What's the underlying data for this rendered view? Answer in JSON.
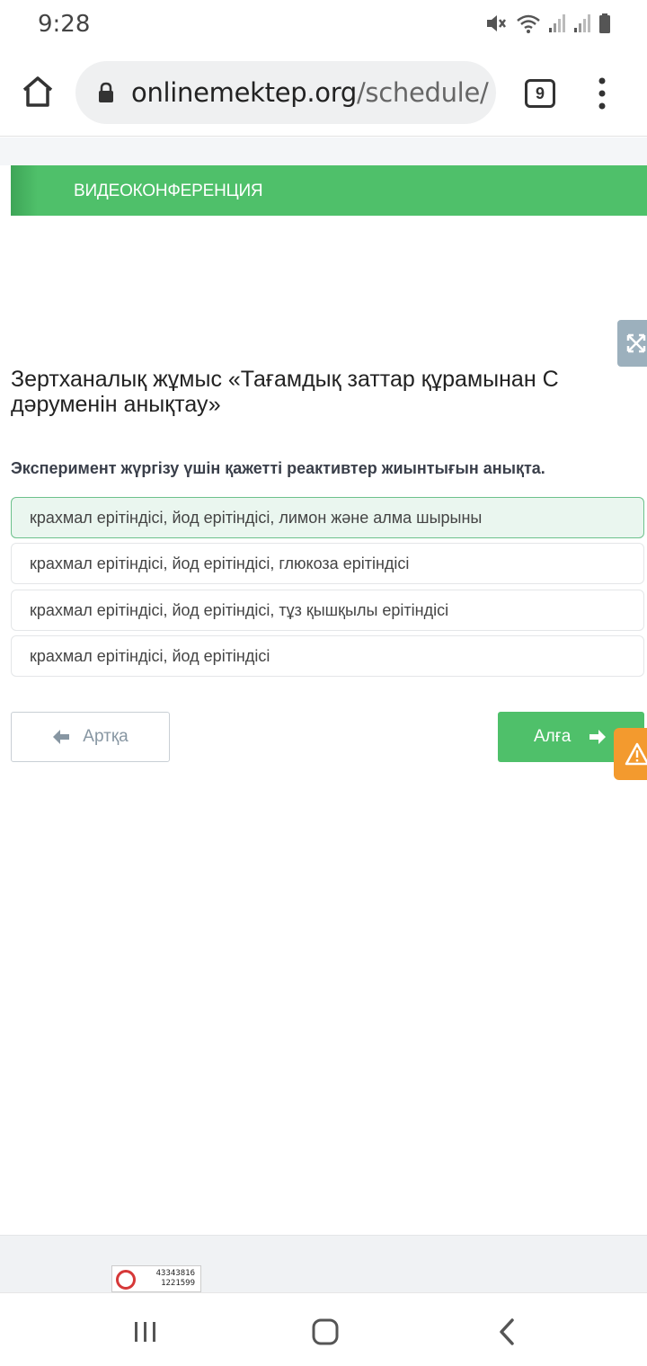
{
  "status_bar": {
    "time": "9:28",
    "icons": [
      "mute-icon",
      "wifi-icon",
      "signal-icon",
      "signal-icon",
      "battery-icon"
    ]
  },
  "browser": {
    "url_domain": "onlinemektep.org",
    "url_path": "/schedule/",
    "tab_count": "9",
    "icons": [
      "home-icon",
      "lock-icon",
      "more-vert-icon"
    ]
  },
  "banner": {
    "label": "ВИДЕОКОНФЕРЕНЦИЯ"
  },
  "task": {
    "title": "Зертханалық жұмыс «Тағамдық заттар құрамынан С дәруменін анықтау»",
    "question": "Эксперимент жүргізу үшін қажетті реактивтер жиынтығын анықта.",
    "options": [
      {
        "text": "крахмал ерітіндісі, йод ерітіндісі, лимон және алма шырыны",
        "selected": true
      },
      {
        "text": "крахмал ерітіндісі, йод ерітіндісі, глюкоза ерітіндісі",
        "selected": false
      },
      {
        "text": "крахмал ерітіндісі, йод ерітіндісі, тұз қышқылы ерітіндісі",
        "selected": false
      },
      {
        "text": "крахмал ерітіндісі, йод ерітіндісі",
        "selected": false
      }
    ]
  },
  "navigation": {
    "back_label": "Артқа",
    "next_label": "Алға"
  },
  "counter": {
    "lines": [
      "43343816",
      "1221599"
    ]
  },
  "colors": {
    "accent_green": "#4fc06a",
    "selected_option_bg": "#eaf6ef",
    "alert_orange": "#f39a2e"
  }
}
